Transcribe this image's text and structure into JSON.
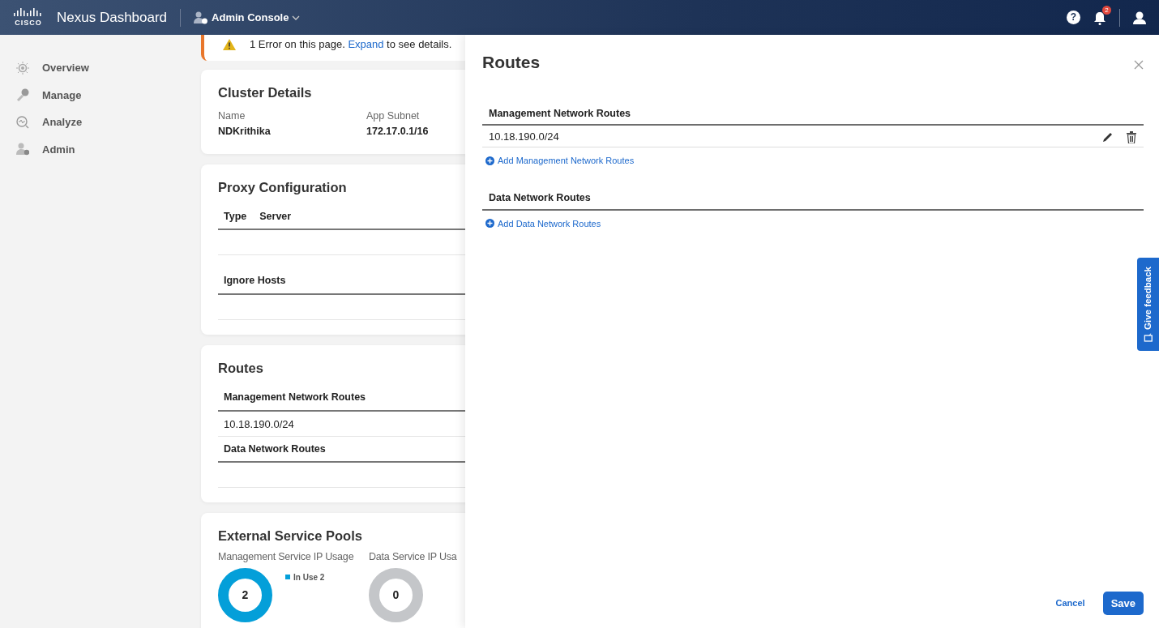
{
  "header": {
    "logo_text": "CISCO",
    "app_title": "Nexus Dashboard",
    "console": "Admin Console",
    "notification_count": "2",
    "help_label": "?"
  },
  "sidebar": {
    "items": [
      {
        "label": "Overview",
        "kind": "overview"
      },
      {
        "label": "Manage",
        "kind": "manage"
      },
      {
        "label": "Analyze",
        "kind": "analyze"
      },
      {
        "label": "Admin",
        "kind": "admin"
      }
    ]
  },
  "alert": {
    "before": "1 Error on this page.",
    "link": "Expand",
    "after": "to see details."
  },
  "cluster_details": {
    "title": "Cluster Details",
    "fields": [
      {
        "label": "Name",
        "value": "NDKrithika"
      },
      {
        "label": "App Subnet",
        "value": "172.17.0.1/16"
      }
    ]
  },
  "proxy_configuration": {
    "title": "Proxy Configuration",
    "columns": [
      "Type",
      "Server"
    ],
    "ignore_hosts_heading": "Ignore Hosts"
  },
  "routes_card": {
    "title": "Routes",
    "sections": [
      {
        "heading": "Management Network Routes",
        "rows": [
          "10.18.190.0/24"
        ]
      },
      {
        "heading": "Data Network Routes"
      }
    ]
  },
  "external_service_pools": {
    "title": "External Service Pools",
    "pools": [
      {
        "title": "Management Service IP Usage",
        "center": "2",
        "legend": [
          {
            "label": "In Use",
            "value": "2",
            "color": "#049fd9"
          }
        ]
      },
      {
        "title": "Data Service IP Usa",
        "center": "0"
      }
    ]
  },
  "routes_panel": {
    "title": "Routes",
    "sections": [
      {
        "heading": "Management Network Routes",
        "routes": [
          "10.18.190.0/24"
        ],
        "add_link": "Add Management Network Routes"
      },
      {
        "heading": "Data Network Routes",
        "add_link": "Add Data Network Routes"
      }
    ],
    "buttons": {
      "cancel": "Cancel",
      "save": "Save"
    }
  },
  "feedback_tab": {
    "label": "Give feedback"
  }
}
